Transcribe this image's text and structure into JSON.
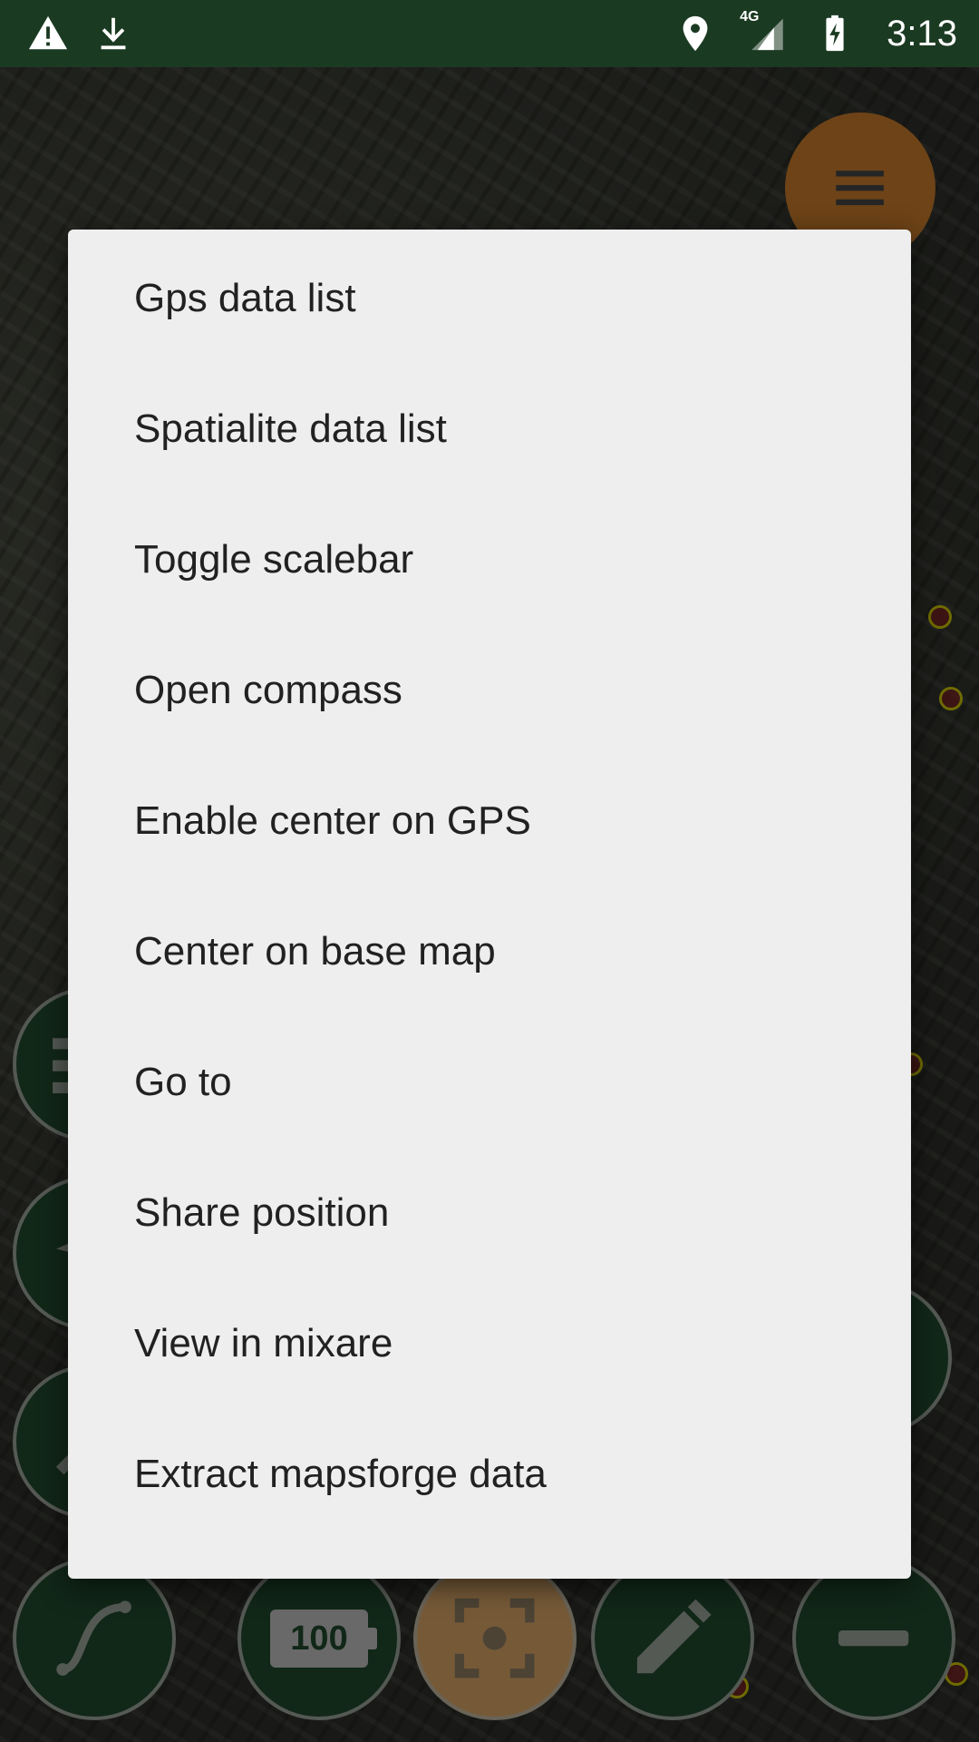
{
  "status_bar": {
    "time": "3:13",
    "icons_left": [
      "warning-icon",
      "download-icon"
    ],
    "icons_right": [
      "location-pin-icon",
      "signal-4g-icon",
      "battery-charging-icon"
    ],
    "network_label": "4G"
  },
  "map": {
    "menu_button_icon": "hamburger-icon",
    "zoom_level_label": "100",
    "bottom_buttons": [
      "track-icon",
      "battery-100-icon",
      "center-crosshair-icon",
      "edit-pencil-icon",
      "zoom-out-minus-icon"
    ]
  },
  "menu": {
    "items": [
      {
        "label": "Gps data list"
      },
      {
        "label": "Spatialite data list"
      },
      {
        "label": "Toggle scalebar"
      },
      {
        "label": "Open compass"
      },
      {
        "label": "Enable center on GPS"
      },
      {
        "label": "Center on base map"
      },
      {
        "label": "Go to"
      },
      {
        "label": "Share position"
      },
      {
        "label": "View in mixare"
      },
      {
        "label": "Extract mapsforge data"
      }
    ]
  },
  "colors": {
    "status_bar": "#1b3a22",
    "menu_background": "#eeeeee",
    "fab_green": "#20482c",
    "fab_orange": "#c67a2a"
  }
}
